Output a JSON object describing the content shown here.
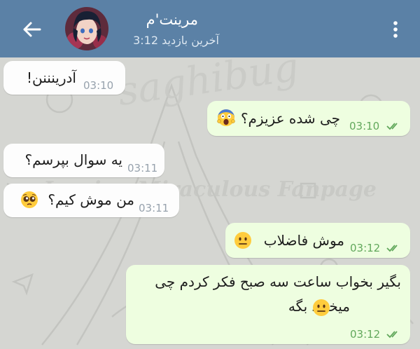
{
  "header": {
    "contact_name": "مرینت'م",
    "last_seen": "آخرین بازدید 3:12",
    "icons": [
      "back-arrow-icon",
      "avatar-image",
      "more-vert-icon"
    ],
    "background_color": "#5b81a6"
  },
  "watermark": {
    "line1": "saghibug",
    "line2": "Iranian Miraculous Fanpage"
  },
  "messages": [
    {
      "direction": "incoming",
      "text": "آدرینننن!",
      "time": "03:10"
    },
    {
      "direction": "outgoing",
      "text": "چی شده عزیزم؟",
      "emoji": "screaming-face-emoji",
      "time": "03:10",
      "read": true
    },
    {
      "direction": "incoming",
      "text": "یه سوال بپرسم؟",
      "time": "03:11"
    },
    {
      "direction": "incoming",
      "text": "من موش کیم؟",
      "emoji": "pleading-face-emoji",
      "time": "03:11"
    },
    {
      "direction": "outgoing",
      "text": "موش فاضلاب",
      "emoji": "neutral-face-emoji",
      "time": "03:12",
      "read": true
    },
    {
      "direction": "outgoing",
      "lines": [
        "بگیر بخواب ساعت سه صبح فکر کردم چی",
        "میخواد بگه"
      ],
      "emoji": "neutral-face-emoji",
      "time": "03:12",
      "read": true
    }
  ],
  "colors": {
    "incoming_bubble": "#fdfdfd",
    "outgoing_bubble": "#eefee0",
    "outgoing_time": "#62a85c",
    "incoming_time": "#97a2ad"
  }
}
